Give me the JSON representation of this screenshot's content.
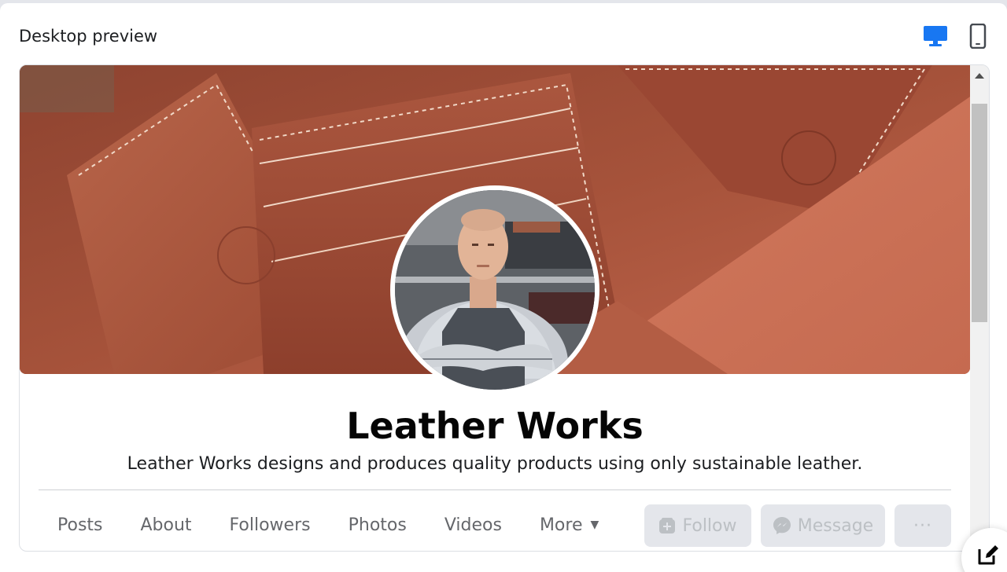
{
  "panel": {
    "title": "Desktop preview"
  },
  "view_toggle": {
    "desktop_icon": "desktop-monitor-icon",
    "mobile_icon": "mobile-phone-icon",
    "selected": "desktop",
    "active_color": "#1877f2",
    "inactive_color": "#444950"
  },
  "page": {
    "name": "Leather Works",
    "description": "Leather Works designs and produces quality products using only sustainable leather.",
    "cover_image": "leather-wallets-cover-photo",
    "profile_image": "craftsman-in-apron-portrait"
  },
  "tabs": [
    {
      "label": "Posts"
    },
    {
      "label": "About"
    },
    {
      "label": "Followers"
    },
    {
      "label": "Photos"
    },
    {
      "label": "Videos"
    },
    {
      "label": "More"
    }
  ],
  "actions": {
    "follow_label": "Follow",
    "message_label": "Message",
    "more_label": "···",
    "follow_icon": "follow-plus-icon",
    "message_icon": "messenger-icon",
    "disabled": true
  },
  "colors": {
    "accent": "#1877f2",
    "tab_text": "#65676b",
    "button_bg": "#e4e6eb",
    "button_text": "#bcc0c4"
  }
}
